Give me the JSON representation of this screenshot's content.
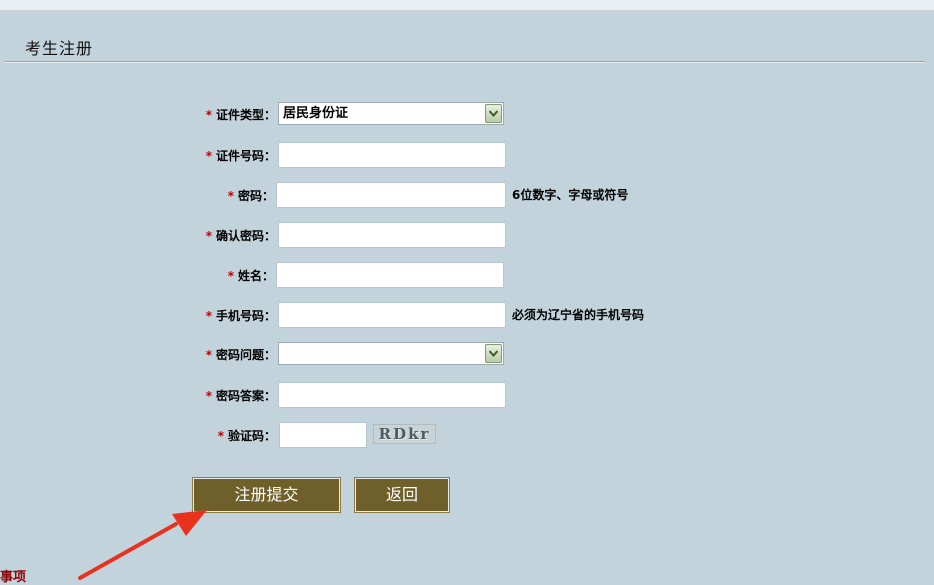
{
  "header": {
    "title": "考生注册"
  },
  "form": {
    "id_type": {
      "required_mark": "*",
      "label": "证件类型：",
      "selected": "居民身份证"
    },
    "id_number": {
      "required_mark": "*",
      "label": "证件号码：",
      "value": ""
    },
    "password": {
      "required_mark": "*",
      "label": "密码：",
      "value": "",
      "hint": "6位数字、字母或符号"
    },
    "confirm_password": {
      "required_mark": "*",
      "label": "确认密码：",
      "value": ""
    },
    "name": {
      "required_mark": "*",
      "label": "姓名：",
      "value": ""
    },
    "phone": {
      "required_mark": "*",
      "label": "手机号码：",
      "value": "",
      "hint": "必须为辽宁省的手机号码"
    },
    "security_question": {
      "required_mark": "*",
      "label": "密码问题：",
      "selected": ""
    },
    "security_answer": {
      "required_mark": "*",
      "label": "密码答案：",
      "value": ""
    },
    "captcha": {
      "required_mark": "*",
      "label": "验证码：",
      "value": "",
      "image_text": "RDkr"
    }
  },
  "buttons": {
    "submit_label": "注册提交",
    "back_label": "返回"
  },
  "footer": {
    "notice_partial": "事项"
  },
  "colors": {
    "background": "#c3d3dc",
    "button": "#6f5f2b",
    "required": "#c00000",
    "annotation_arrow": "#e8321e"
  },
  "icons": {
    "select_arrow": "chevron-down-icon",
    "annotation": "red-arrow-icon"
  }
}
